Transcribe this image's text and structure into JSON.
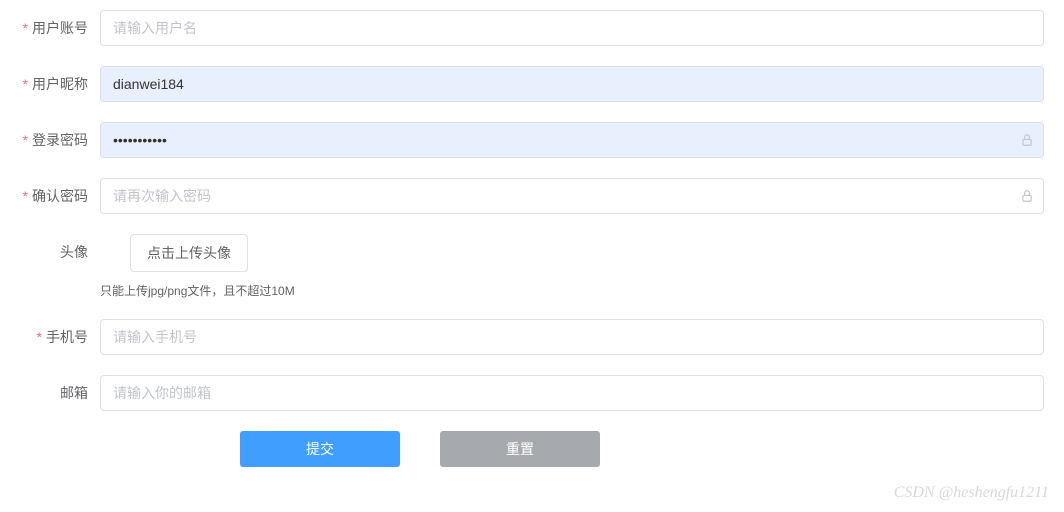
{
  "form": {
    "username": {
      "label": "用户账号",
      "placeholder": "请输入用户名",
      "value": ""
    },
    "nickname": {
      "label": "用户昵称",
      "placeholder": "",
      "value": "dianwei184"
    },
    "password": {
      "label": "登录密码",
      "placeholder": "",
      "value": "•••••••••••"
    },
    "confirm_password": {
      "label": "确认密码",
      "placeholder": "请再次输入密码",
      "value": ""
    },
    "avatar": {
      "label": "头像",
      "upload_button": "点击上传头像",
      "hint": "只能上传jpg/png文件，且不超过10M"
    },
    "phone": {
      "label": "手机号",
      "placeholder": "请输入手机号",
      "value": ""
    },
    "email": {
      "label": "邮箱",
      "placeholder": "请输入你的邮箱",
      "value": ""
    }
  },
  "actions": {
    "submit": "提交",
    "reset": "重置"
  },
  "watermark": "CSDN @heshengfu1211"
}
